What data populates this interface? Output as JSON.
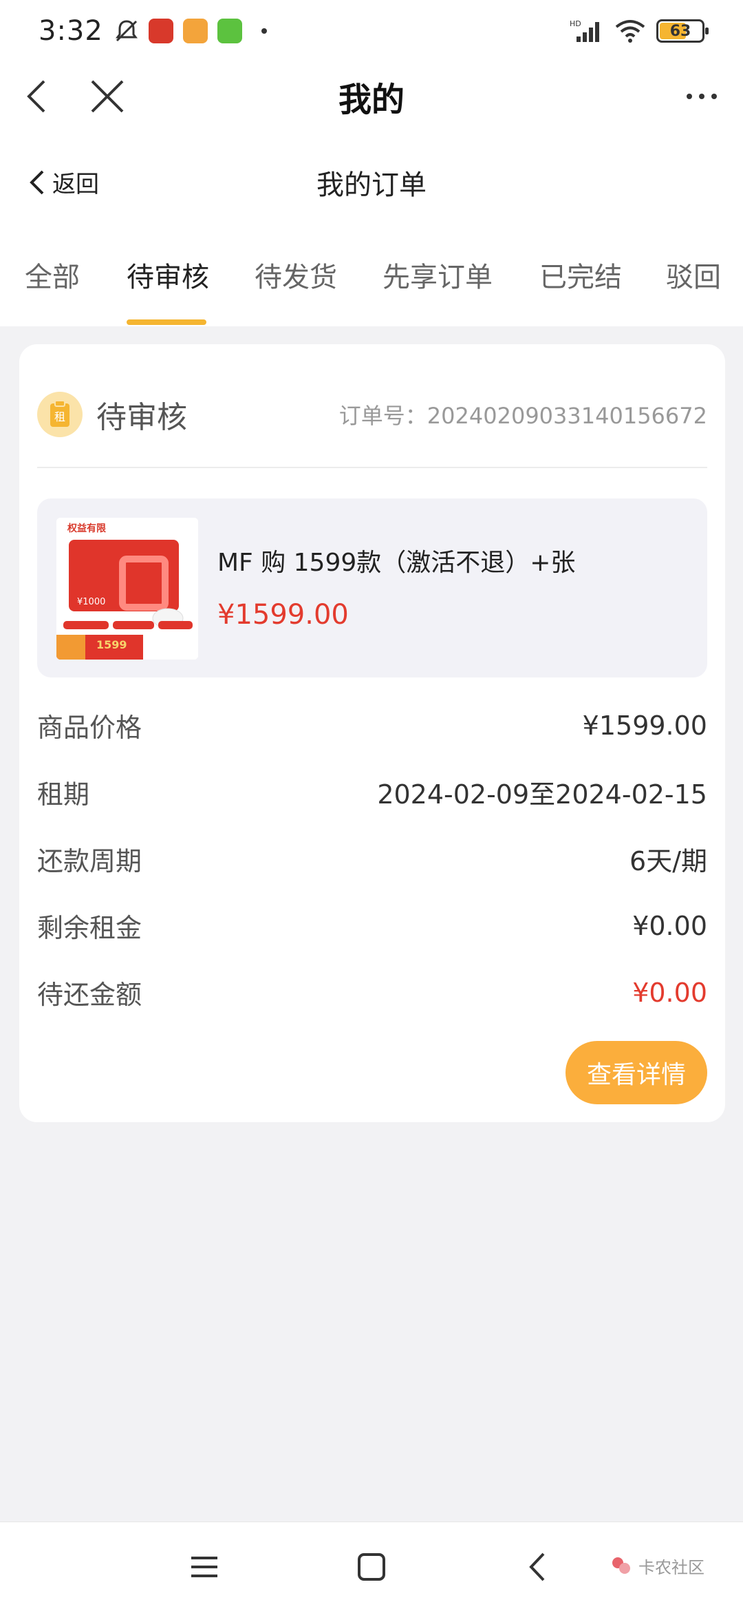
{
  "status_bar": {
    "time": "3:32",
    "battery": "63",
    "network": "HD"
  },
  "title_bar": {
    "title": "我的"
  },
  "sub_header": {
    "back_label": "返回",
    "title": "我的订单"
  },
  "tabs": [
    {
      "label": "全部",
      "active": false
    },
    {
      "label": "待审核",
      "active": true
    },
    {
      "label": "待发货",
      "active": false
    },
    {
      "label": "先享订单",
      "active": false
    },
    {
      "label": "已完结",
      "active": false
    },
    {
      "label": "驳回",
      "active": false
    }
  ],
  "order": {
    "status": "待审核",
    "order_no": "订单号：20240209033140156672",
    "product": {
      "name": "MF 购 1599款（激活不退）+张",
      "price": "¥1599.00",
      "thumb_texts": {
        "badge": "权益有限",
        "amount": "¥1000",
        "promo": "1599"
      }
    },
    "rows": [
      {
        "label": "商品价格",
        "value": "¥1599.00",
        "highlight": false
      },
      {
        "label": "租期",
        "value": "2024-02-09至2024-02-15",
        "highlight": false
      },
      {
        "label": "还款周期",
        "value": "6天/期",
        "highlight": false
      },
      {
        "label": "剩余租金",
        "value": "¥0.00",
        "highlight": false
      },
      {
        "label": "待还金额",
        "value": "¥0.00",
        "highlight": true
      }
    ],
    "detail_button": "查看详情"
  },
  "watermark": {
    "text": "卡农社区"
  },
  "colors": {
    "accent": "#f5b531",
    "button": "#fbae3c",
    "price_red": "#e33b2e"
  }
}
